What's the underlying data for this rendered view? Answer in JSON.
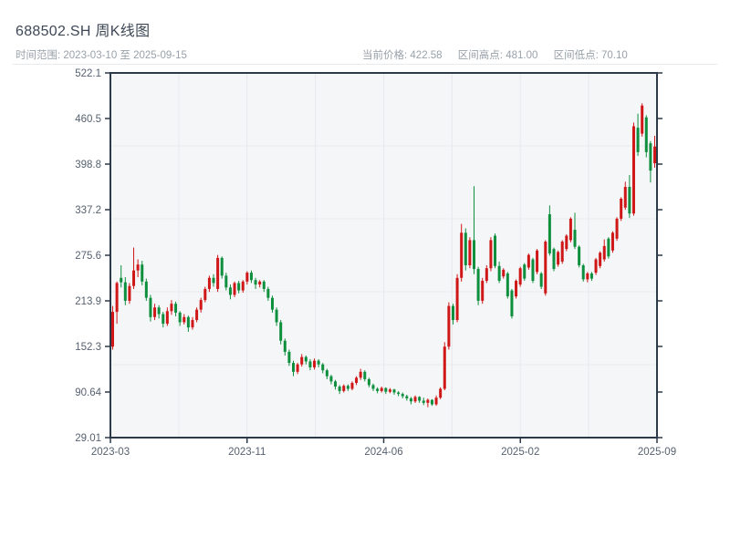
{
  "header": {
    "title": "688502.SH 周K线图",
    "subtitle": "时间范围: 2023-03-10 至 2025-09-15",
    "stats": [
      {
        "label": "当前价格:",
        "value": "422.58"
      },
      {
        "label": "区间高点:",
        "value": "481.00"
      },
      {
        "label": "区间低点:",
        "value": "70.10"
      }
    ]
  },
  "chart_data": {
    "type": "candlestick",
    "title": "688502.SH 周K线图",
    "xlabel": "",
    "ylabel": "",
    "x_ticks": [
      "2023-03",
      "2023-11",
      "2024-06",
      "2025-02",
      "2025-09"
    ],
    "y_ticks": [
      "522.1",
      "460.5",
      "398.8",
      "337.2",
      "275.6",
      "213.9",
      "152.3",
      "90.64",
      "29.01"
    ],
    "ylim": [
      29.01,
      522.1
    ],
    "grid": true,
    "legend": "none",
    "up_color": "#cf1717",
    "down_color": "#0e8f3e",
    "plot_bg": "#f5f6f8",
    "grid_color": "#e8e9ec",
    "axis_color": "#2b3948",
    "tick_label_color": "#56616f",
    "current_price": 422.58,
    "range_high": 481.0,
    "range_low": 70.1,
    "candles_format": [
      "open",
      "high",
      "low",
      "close"
    ],
    "candles": [
      [
        152,
        207,
        148,
        199
      ],
      [
        199,
        240,
        183,
        238
      ],
      [
        245,
        262,
        232,
        239
      ],
      [
        239,
        246,
        208,
        214
      ],
      [
        214,
        238,
        210,
        234
      ],
      [
        234,
        286,
        230,
        255
      ],
      [
        255,
        270,
        246,
        263
      ],
      [
        263,
        268,
        235,
        240
      ],
      [
        240,
        244,
        214,
        218
      ],
      [
        218,
        222,
        186,
        192
      ],
      [
        192,
        210,
        188,
        205
      ],
      [
        205,
        208,
        190,
        196
      ],
      [
        196,
        199,
        178,
        183
      ],
      [
        183,
        205,
        180,
        200
      ],
      [
        200,
        215,
        195,
        210
      ],
      [
        210,
        213,
        193,
        198
      ],
      [
        198,
        200,
        180,
        185
      ],
      [
        185,
        196,
        182,
        192
      ],
      [
        192,
        194,
        172,
        178
      ],
      [
        178,
        192,
        175,
        188
      ],
      [
        188,
        205,
        185,
        202
      ],
      [
        202,
        218,
        198,
        215
      ],
      [
        215,
        233,
        212,
        230
      ],
      [
        230,
        248,
        226,
        245
      ],
      [
        245,
        250,
        233,
        238
      ],
      [
        230,
        276,
        226,
        272
      ],
      [
        272,
        274,
        244,
        248
      ],
      [
        248,
        252,
        228,
        232
      ],
      [
        232,
        236,
        216,
        222
      ],
      [
        222,
        240,
        219,
        238
      ],
      [
        238,
        241,
        224,
        228
      ],
      [
        228,
        242,
        225,
        240
      ],
      [
        240,
        254,
        236,
        252
      ],
      [
        252,
        255,
        238,
        242
      ],
      [
        242,
        245,
        230,
        236
      ],
      [
        236,
        242,
        232,
        240
      ],
      [
        240,
        242,
        226,
        230
      ],
      [
        230,
        233,
        214,
        218
      ],
      [
        218,
        221,
        198,
        202
      ],
      [
        202,
        205,
        180,
        185
      ],
      [
        185,
        188,
        155,
        160
      ],
      [
        160,
        163,
        140,
        145
      ],
      [
        145,
        148,
        126,
        130
      ],
      [
        130,
        133,
        112,
        118
      ],
      [
        118,
        130,
        115,
        128
      ],
      [
        128,
        142,
        125,
        138
      ],
      [
        138,
        140,
        128,
        132
      ],
      [
        132,
        135,
        120,
        124
      ],
      [
        124,
        136,
        121,
        133
      ],
      [
        133,
        135,
        124,
        128
      ],
      [
        128,
        130,
        116,
        120
      ],
      [
        120,
        122,
        108,
        112
      ],
      [
        112,
        114,
        101,
        105
      ],
      [
        105,
        107,
        94,
        98
      ],
      [
        98,
        100,
        88,
        92
      ],
      [
        92,
        101,
        90,
        99
      ],
      [
        99,
        101,
        92,
        95
      ],
      [
        95,
        105,
        93,
        103
      ],
      [
        103,
        112,
        100,
        110
      ],
      [
        110,
        122,
        107,
        118
      ],
      [
        118,
        120,
        105,
        108
      ],
      [
        108,
        110,
        97,
        100
      ],
      [
        100,
        102,
        92,
        95
      ],
      [
        95,
        97,
        89,
        92
      ],
      [
        92,
        98,
        90,
        96
      ],
      [
        96,
        97,
        88,
        91
      ],
      [
        91,
        96,
        89,
        94
      ],
      [
        94,
        95,
        87,
        90
      ],
      [
        90,
        92,
        85,
        88
      ],
      [
        88,
        90,
        82,
        85
      ],
      [
        85,
        87,
        79,
        82
      ],
      [
        82,
        84,
        74,
        78
      ],
      [
        78,
        86,
        76,
        84
      ],
      [
        84,
        85,
        76,
        79
      ],
      [
        79,
        83,
        73,
        76
      ],
      [
        76,
        82,
        70.1,
        80
      ],
      [
        80,
        81,
        72,
        74
      ],
      [
        74,
        86,
        72,
        83
      ],
      [
        83,
        97,
        81,
        95
      ],
      [
        95,
        158,
        93,
        152
      ],
      [
        152,
        212,
        148,
        207
      ],
      [
        207,
        210,
        182,
        188
      ],
      [
        188,
        250,
        185,
        245
      ],
      [
        245,
        318,
        240,
        306
      ],
      [
        306,
        312,
        255,
        262
      ],
      [
        262,
        300,
        258,
        296
      ],
      [
        296,
        369,
        250,
        257
      ],
      [
        257,
        260,
        208,
        214
      ],
      [
        214,
        245,
        210,
        241
      ],
      [
        241,
        262,
        238,
        258
      ],
      [
        258,
        300,
        254,
        296
      ],
      [
        302,
        305,
        258,
        261
      ],
      [
        261,
        267,
        238,
        241
      ],
      [
        247,
        258,
        244,
        256
      ],
      [
        251,
        253,
        217,
        220
      ],
      [
        228,
        230,
        190,
        193
      ],
      [
        220,
        243,
        217,
        241
      ],
      [
        236,
        260,
        233,
        258
      ],
      [
        263,
        265,
        241,
        244
      ],
      [
        259,
        278,
        256,
        276
      ],
      [
        270,
        272,
        238,
        241
      ],
      [
        253,
        284,
        250,
        282
      ],
      [
        251,
        253,
        230,
        233
      ],
      [
        224,
        296,
        221,
        294
      ],
      [
        331,
        343,
        275,
        278
      ],
      [
        284,
        286,
        254,
        257
      ],
      [
        263,
        282,
        260,
        280
      ],
      [
        267,
        296,
        264,
        294
      ],
      [
        284,
        304,
        281,
        302
      ],
      [
        296,
        327,
        293,
        325
      ],
      [
        310,
        333,
        284,
        287
      ],
      [
        287,
        289,
        259,
        262
      ],
      [
        262,
        264,
        240,
        243
      ],
      [
        243,
        253,
        239,
        251
      ],
      [
        251,
        253,
        241,
        244
      ],
      [
        252,
        272,
        249,
        270
      ],
      [
        261,
        281,
        258,
        279
      ],
      [
        270,
        297,
        267,
        288
      ],
      [
        298,
        300,
        271,
        274
      ],
      [
        282,
        308,
        279,
        306
      ],
      [
        298,
        327,
        295,
        325
      ],
      [
        325,
        354,
        322,
        352
      ],
      [
        340,
        375,
        337,
        368
      ],
      [
        368,
        384,
        326,
        332
      ],
      [
        332,
        455,
        329,
        450
      ],
      [
        448,
        467,
        410,
        415
      ],
      [
        440,
        481,
        436,
        478
      ],
      [
        462,
        465,
        408,
        415
      ],
      [
        427,
        430,
        374,
        390
      ],
      [
        400,
        437,
        394,
        422.58
      ]
    ]
  }
}
